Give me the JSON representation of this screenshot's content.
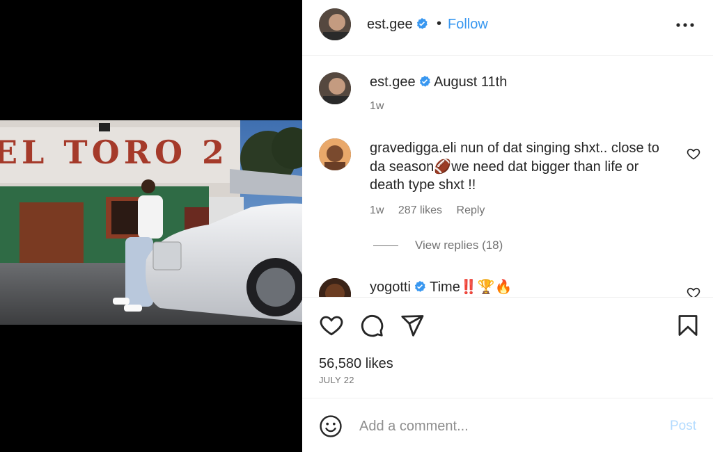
{
  "post": {
    "author": "est.gee",
    "follow_label": "Follow",
    "separator": "•",
    "likes": "56,580 likes",
    "date": "JULY 22"
  },
  "caption": {
    "username": "est.gee",
    "text": "August 11th",
    "age": "1w"
  },
  "comments": [
    {
      "username": "gravedigga.eli",
      "line1": "nun of dat singing shxt.. close to",
      "line2": "da season🏈we need dat bigger than life or",
      "line3": "death type shxt !!",
      "age": "1w",
      "likes": "287 likes",
      "reply_label": "Reply",
      "view_replies": "View replies (18)"
    },
    {
      "username": "yogotti",
      "text": "Time‼️🏆🔥"
    }
  ],
  "composer": {
    "placeholder": "Add a comment...",
    "post_label": "Post"
  },
  "colors": {
    "follow": "#3797f0",
    "verified": "#3897f0",
    "post_disabled": "#b3dbff",
    "muted": "#737373"
  },
  "photo_sign": "EL TORO 2"
}
